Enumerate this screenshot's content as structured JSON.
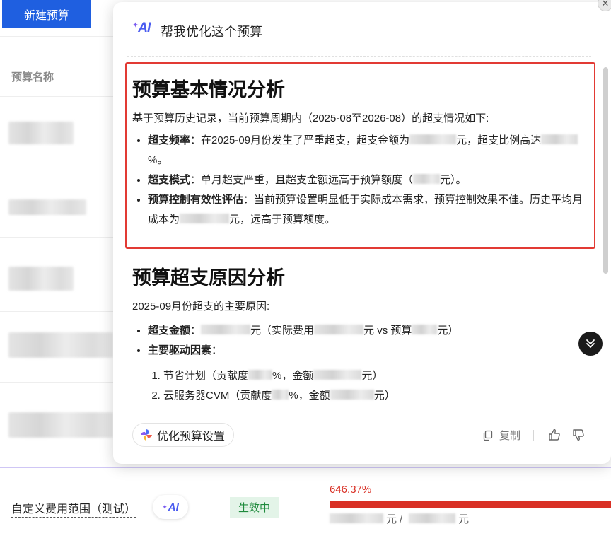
{
  "background": {
    "new_budget_label": "新建预算",
    "column_header": "预算名称"
  },
  "popup": {
    "ai_badge": "AI",
    "title": "帮我优化这个预算",
    "section1": {
      "heading": "预算基本情况分析",
      "intro": "基于预算历史记录，当前预算周期内（2025-08至2026-08）的超支情况如下:",
      "item1_label": "超支频率",
      "item1_text_a": "：在2025-09月份发生了严重超支，超支金额为",
      "item1_text_b": "元，超支比例高达",
      "item1_text_c": "%。",
      "item2_label": "超支模式",
      "item2_text_a": "：单月超支严重，且超支金额远高于预算额度（",
      "item2_text_b": "元）。",
      "item3_label": "预算控制有效性评估",
      "item3_text_a": "：当前预算设置明显低于实际成本需求，预算控制效果不佳。历史平均月成本为",
      "item3_text_b": "元，远高于预算额度。"
    },
    "section2": {
      "heading": "预算超支原因分析",
      "intro": "2025-09月份超支的主要原因:",
      "item1_label": "超支金额",
      "item1_text_a": "：",
      "item1_text_b": "元（实际费用",
      "item1_text_c": "元 vs 预算",
      "item1_text_d": "元）",
      "item2_label": "主要驱动因素",
      "item2_text": "：",
      "sub1_a": "节省计划（贡献度",
      "sub1_b": "%，金额",
      "sub1_c": "元）",
      "sub2_a": "云服务器CVM（贡献度",
      "sub2_b": "%，金额",
      "sub2_c": "元）"
    },
    "footer": {
      "optimize_label": "优化预算设置",
      "copy_label": "复制"
    }
  },
  "budget_row": {
    "name": "自定义费用范围（测试）",
    "ai_badge": "AI",
    "status": "生效中",
    "usage_percent": "646.37%",
    "usage_fraction": 1.0,
    "amount_unit_a": "元 /",
    "amount_unit_b": "元"
  },
  "colors": {
    "primary": "#1f5fe0",
    "danger": "#d93025",
    "success": "#1e8a3c",
    "ai_accent": "#4a5cf0"
  },
  "icons": [
    "ai-logo-icon",
    "close-icon",
    "chevron-double-down-icon",
    "pinwheel-icon",
    "copy-icon",
    "thumbs-up-icon",
    "thumbs-down-icon"
  ]
}
